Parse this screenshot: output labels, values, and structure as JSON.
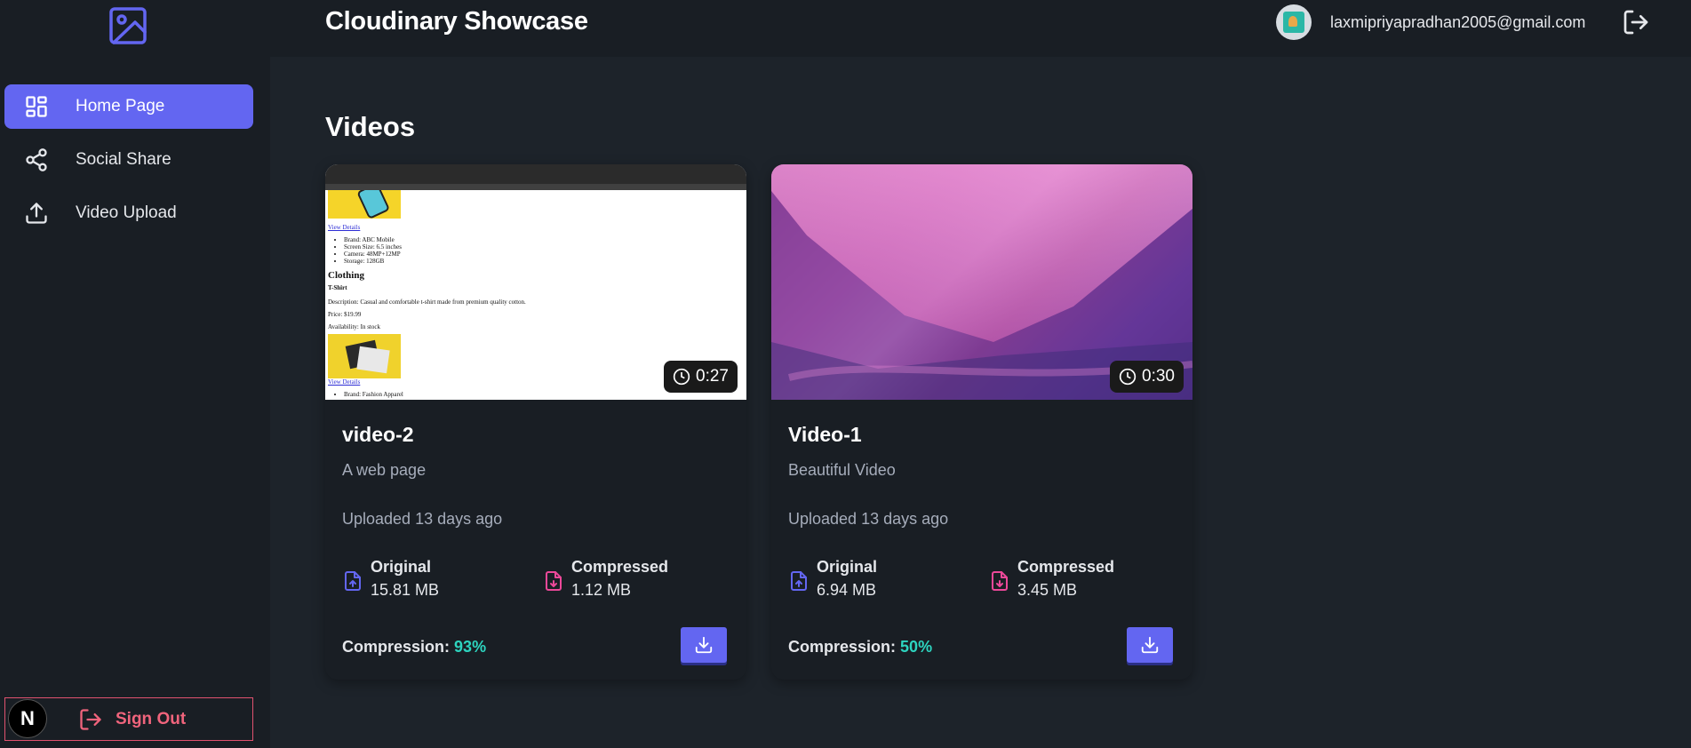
{
  "colors": {
    "accent": "#6366f1",
    "background": "#1d232a",
    "sidebar": "#191e24",
    "success": "#2dd4bf",
    "danger": "#f0647c"
  },
  "sidebar": {
    "logo_icon": "image-icon",
    "items": [
      {
        "label": "Home Page",
        "icon": "layout-dashboard-icon",
        "active": true
      },
      {
        "label": "Social Share",
        "icon": "share-icon",
        "active": false
      },
      {
        "label": "Video Upload",
        "icon": "upload-icon",
        "active": false
      }
    ],
    "sign_out_label": "Sign Out",
    "badge_letter": "N"
  },
  "header": {
    "title": "Cloudinary Showcase",
    "email": "laxmipriyapradhan2005@gmail.com"
  },
  "main": {
    "section_title": "Videos",
    "compression_label": "Compression:",
    "original_label": "Original",
    "compressed_label": "Compressed",
    "videos": [
      {
        "title": "video-2",
        "description": "A web page",
        "duration": "0:27",
        "uploaded": "Uploaded 13 days ago",
        "original_size": "15.81 MB",
        "compressed_size": "1.12 MB",
        "compression": "93%"
      },
      {
        "title": "Video-1",
        "description": "Beautiful Video",
        "duration": "0:30",
        "uploaded": "Uploaded 13 days ago",
        "original_size": "6.94 MB",
        "compressed_size": "3.45 MB",
        "compression": "50%"
      }
    ]
  },
  "preview_page": {
    "view_details": "View Details",
    "specs": [
      "Brand: ABC Mobile",
      "Screen Size: 6.5 inches",
      "Camera: 48MP+12MP",
      "Storage: 128GB"
    ],
    "category": "Clothing",
    "product": "T-Shirt",
    "description": "Description: Casual and comfortable t-shirt made from premium quality cotton.",
    "price": "Price: $19.99",
    "availability": "Availability: In stock",
    "brand2": "Brand: Fashion Apparel"
  }
}
